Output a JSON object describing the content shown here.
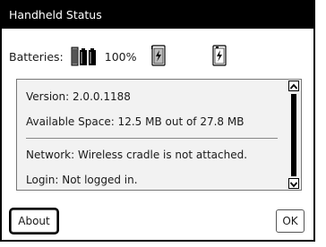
{
  "dialog": {
    "title": "Handheld Status",
    "batteries": {
      "label": "Batteries:",
      "percent": "100%"
    },
    "info": {
      "version": "Version: 2.0.0.1188",
      "space": "Available Space: 12.5 MB out of 27.8 MB",
      "network": "Network: Wireless cradle is not attached.",
      "login": "Login: Not logged in."
    },
    "buttons": {
      "about": "About",
      "ok": "OK"
    }
  }
}
